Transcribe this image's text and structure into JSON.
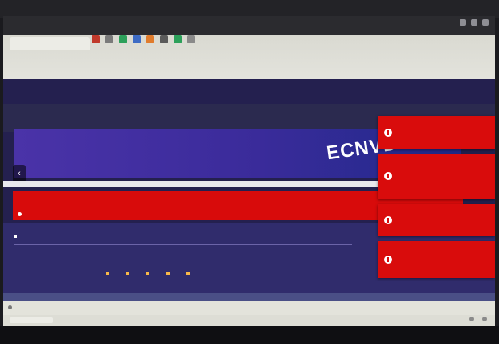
{
  "colors": {
    "accent_red": "#d90c0c",
    "site_dark": "#2b2a4f",
    "banner_purple": "#3a2b9a",
    "highlight_yellow": "#ffd000",
    "breadcrumb_orange": "#f3b56e"
  },
  "browser": {
    "extension_colors": [
      "#c0392b",
      "#7a7a7a",
      "#2ca05a",
      "#3d6bc4",
      "#e07b2c",
      "#5a5a5a",
      "#2ca05a",
      "#8a8a8a"
    ]
  },
  "site": {
    "logo_text": "ECNVDO",
    "logo_sub": "",
    "topnav_link": "",
    "banner_title": "",
    "breadcrumb": "",
    "content_desc": "",
    "mini_label": "",
    "tools": [],
    "right_text": ""
  },
  "alert": {
    "lines": []
  },
  "toasts": [
    {
      "text": "",
      "link": ""
    },
    {
      "text": "",
      "link": ""
    },
    {
      "text": "",
      "link": ""
    },
    {
      "text": "",
      "link": ""
    }
  ],
  "status": {
    "text": ""
  }
}
